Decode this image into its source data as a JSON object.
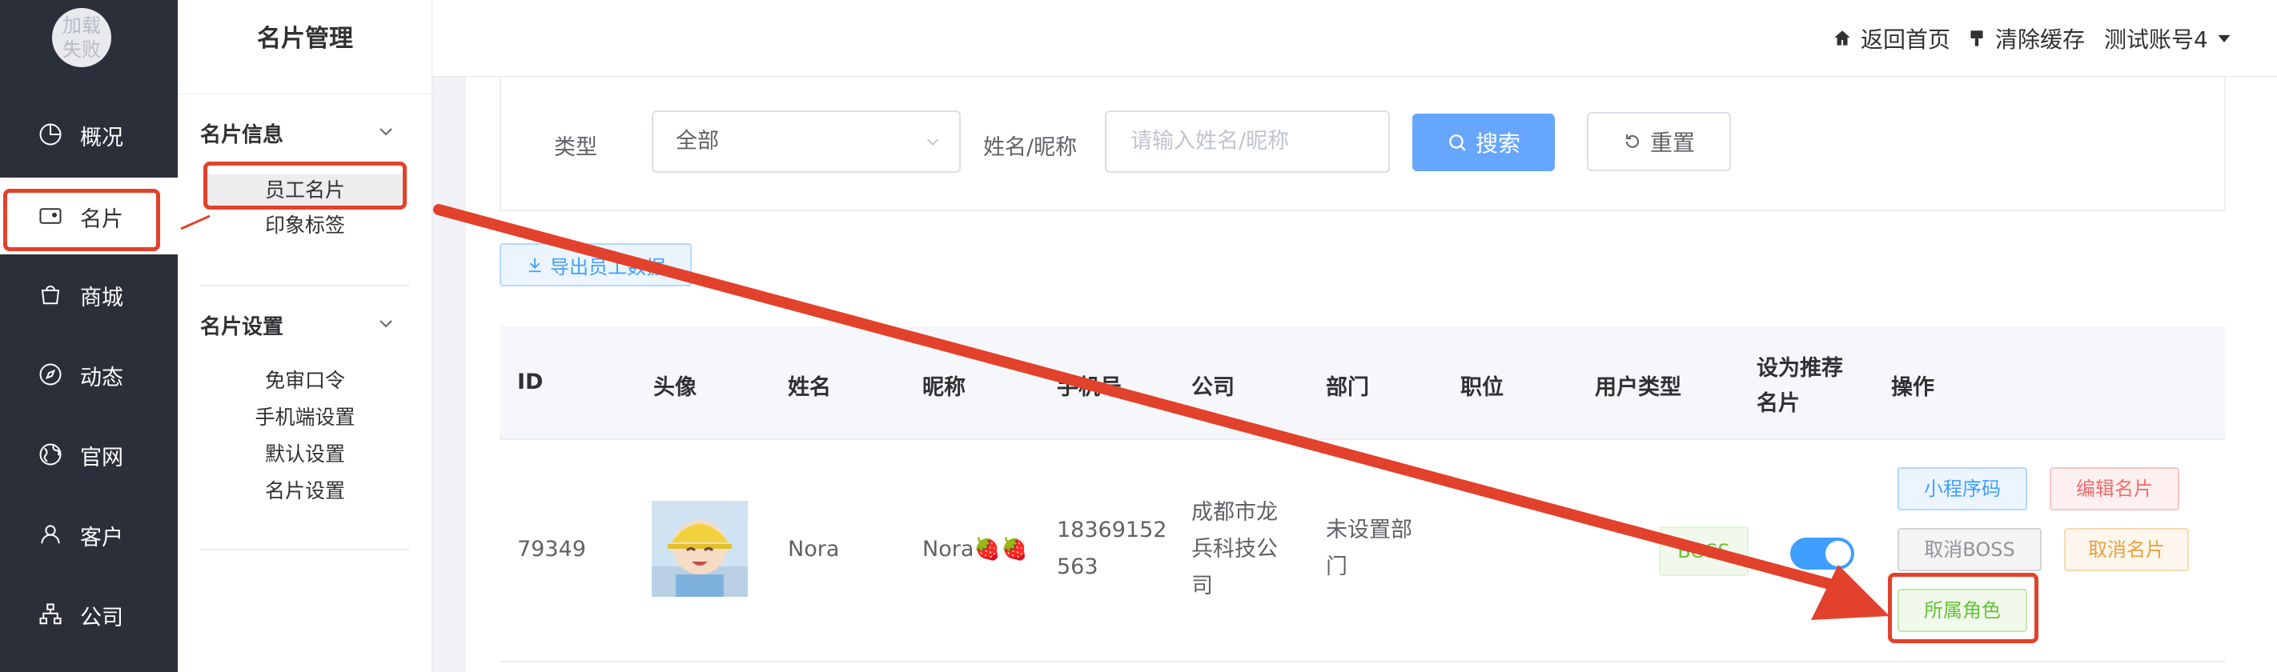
{
  "avatar": {
    "line1": "加载",
    "line2": "失败"
  },
  "nav": {
    "items": [
      {
        "label": "概况",
        "icon": "pie-chart-icon"
      },
      {
        "label": "名片",
        "icon": "wallet-icon",
        "active": true
      },
      {
        "label": "商城",
        "icon": "shopping-bag-icon"
      },
      {
        "label": "动态",
        "icon": "compass-icon"
      },
      {
        "label": "官网",
        "icon": "globe-icon"
      },
      {
        "label": "客户",
        "icon": "user-icon"
      },
      {
        "label": "公司",
        "icon": "org-chart-icon"
      }
    ]
  },
  "sidebar": {
    "title": "名片管理",
    "groups": [
      {
        "title": "名片信息",
        "items": [
          "员工名片",
          "印象标签"
        ]
      },
      {
        "title": "名片设置",
        "items": [
          "免审口令",
          "手机端设置",
          "默认设置",
          "名片设置"
        ]
      }
    ]
  },
  "header": {
    "home": "返回首页",
    "clear_cache": "清除缓存",
    "account": "测试账号4"
  },
  "filter": {
    "type_label": "类型",
    "type_value": "全部",
    "name_label": "姓名/昵称",
    "name_placeholder": "请输入姓名/昵称",
    "search": "搜索",
    "reset": "重置"
  },
  "export_label": "导出员工数据",
  "table": {
    "columns": [
      "ID",
      "头像",
      "姓名",
      "昵称",
      "手机号",
      "公司",
      "部门",
      "职位",
      "用户类型",
      "设为推荐名片",
      "操作"
    ],
    "recommend_col": {
      "line1": "设为推荐",
      "line2": "名片"
    },
    "row": {
      "id": "79349",
      "name": "Nora",
      "nickname": "Nora🍓🍓",
      "phone_line1": "18369152",
      "phone_line2": "563",
      "company_line1": "成都市龙",
      "company_line2": "兵科技公",
      "company_line3": "司",
      "dept_line1": "未设置部",
      "dept_line2": "门",
      "position": "",
      "user_type": "BOSS",
      "recommended": true
    },
    "actions": {
      "mini_code": "小程序码",
      "edit_card": "编辑名片",
      "cancel_boss": "取消BOSS",
      "cancel_card": "取消名片",
      "role": "所属角色"
    }
  },
  "colors": {
    "nav_bg": "#2b2f3a",
    "primary": "#409eff",
    "annotation": "#e2412c"
  }
}
